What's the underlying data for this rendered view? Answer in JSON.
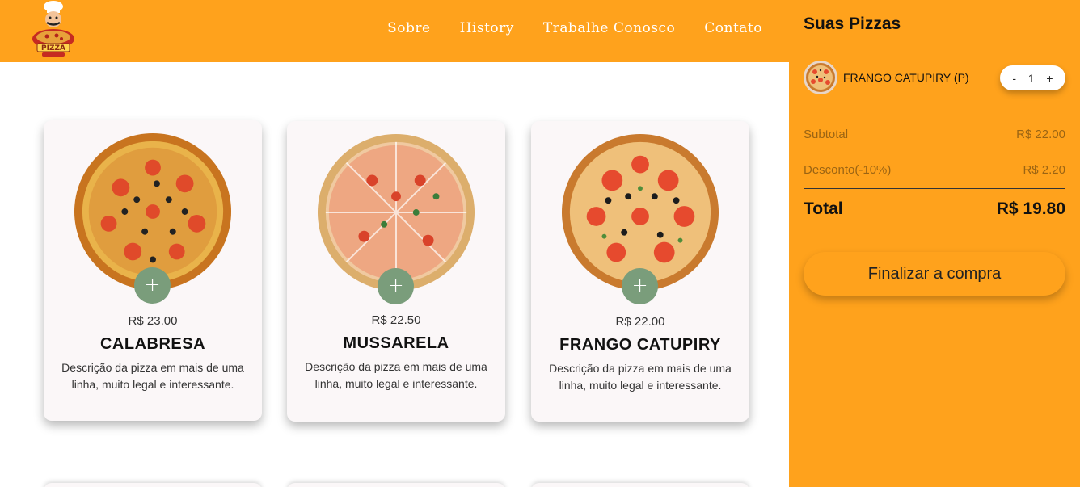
{
  "brand": {
    "logo_text": "PIZZA",
    "icon": "chef-pizza-logo"
  },
  "nav": {
    "items": [
      {
        "label": "Sobre"
      },
      {
        "label": "History"
      },
      {
        "label": "Trabalhe Conosco"
      },
      {
        "label": "Contato"
      }
    ]
  },
  "products": [
    {
      "name": "CALABRESA",
      "price": "R$ 23.00",
      "description": "Descrição da pizza em mais de uma linha, muito legal e interessante.",
      "add_label": "+"
    },
    {
      "name": "MUSSARELA",
      "price": "R$ 22.50",
      "description": "Descrição da pizza em mais de uma linha, muito legal e interessante.",
      "add_label": "+"
    },
    {
      "name": "FRANGO CATUPIRY",
      "price": "R$ 22.00",
      "description": "Descrição da pizza em mais de uma linha, muito legal e interessante.",
      "add_label": "+"
    }
  ],
  "cart": {
    "title": "Suas Pizzas",
    "items": [
      {
        "name": "FRANGO CATUPIRY (P)",
        "qty": "1",
        "minus": "-",
        "plus": "+"
      }
    ],
    "subtotal_label": "Subtotal",
    "subtotal_value": "R$ 22.00",
    "discount_label": "Desconto(-10%)",
    "discount_value": "R$ 2.20",
    "total_label": "Total",
    "total_value": "R$ 19.80",
    "checkout_label": "Finalizar a compra"
  },
  "colors": {
    "accent": "#ffa21c",
    "add_button": "#7a9d7b",
    "card_bg": "#fbf7f8"
  }
}
